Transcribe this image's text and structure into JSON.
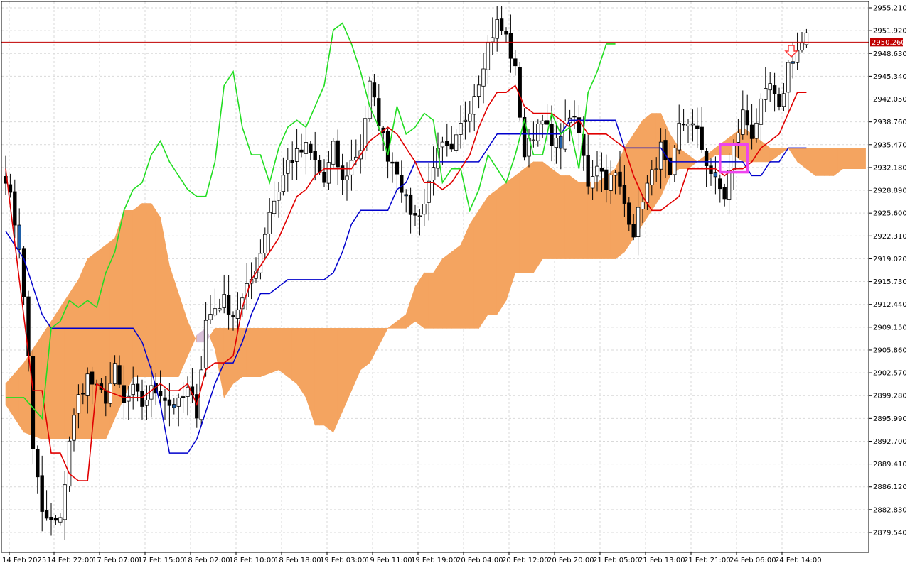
{
  "chart_data": {
    "type": "candlestick",
    "indicator": "ichimoku",
    "current_price": "2950.260",
    "y_ticks": [
      "2955.210",
      "2951.920",
      "2948.630",
      "2945.340",
      "2942.050",
      "2938.760",
      "2935.470",
      "2932.180",
      "2928.890",
      "2925.600",
      "2922.310",
      "2919.020",
      "2915.730",
      "2912.440",
      "2909.150",
      "2905.860",
      "2902.570",
      "2899.280",
      "2895.990",
      "2892.700",
      "2889.410",
      "2886.120",
      "2882.830",
      "2879.540"
    ],
    "x_ticks": [
      "14 Feb 2025",
      "14 Feb 22:00",
      "17 Feb 07:00",
      "17 Feb 15:00",
      "18 Feb 02:00",
      "18 Feb 10:00",
      "18 Feb 18:00",
      "19 Feb 03:00",
      "19 Feb 11:00",
      "19 Feb 19:00",
      "20 Feb 04:00",
      "20 Feb 12:00",
      "20 Feb 20:00",
      "21 Feb 05:00",
      "21 Feb 13:00",
      "21 Feb 21:00",
      "24 Feb 06:00",
      "24 Feb 14:00"
    ],
    "ylim": [
      2876.5,
      2956.8
    ],
    "grid": true,
    "colors": {
      "cloud_bull": "#f4a460",
      "cloud_bear": "#d8bfd8",
      "tenkan": "#e00000",
      "kijun": "#0000cc",
      "chikou": "#22dd22",
      "price_line": "#c00000",
      "highlight_box": "#ee44ee",
      "arrow": "#ff3333"
    },
    "tenkan": [
      [
        0,
        2932
      ],
      [
        6,
        2900
      ],
      [
        8,
        2900
      ],
      [
        10,
        2891
      ],
      [
        12,
        2891
      ],
      [
        14,
        2888
      ],
      [
        16,
        2887
      ],
      [
        18,
        2887
      ],
      [
        20,
        2901
      ],
      [
        22,
        2900
      ],
      [
        26,
        2899
      ],
      [
        30,
        2899
      ],
      [
        34,
        2901
      ],
      [
        36,
        2900
      ],
      [
        38,
        2900
      ],
      [
        40,
        2901
      ],
      [
        42,
        2898
      ],
      [
        44,
        2903
      ],
      [
        46,
        2904
      ],
      [
        48,
        2904
      ],
      [
        50,
        2905
      ],
      [
        52,
        2912
      ],
      [
        54,
        2916
      ],
      [
        56,
        2918
      ],
      [
        58,
        2920
      ],
      [
        60,
        2922
      ],
      [
        62,
        2925
      ],
      [
        64,
        2928
      ],
      [
        66,
        2929
      ],
      [
        68,
        2931
      ],
      [
        70,
        2932
      ],
      [
        72,
        2932
      ],
      [
        74,
        2932
      ],
      [
        76,
        2932
      ],
      [
        78,
        2934
      ],
      [
        80,
        2936
      ],
      [
        82,
        2937
      ],
      [
        84,
        2938
      ],
      [
        86,
        2937
      ],
      [
        88,
        2935
      ],
      [
        90,
        2933
      ],
      [
        92,
        2930
      ],
      [
        94,
        2930
      ],
      [
        96,
        2929
      ],
      [
        98,
        2930
      ],
      [
        100,
        2932
      ],
      [
        102,
        2934
      ],
      [
        104,
        2938
      ],
      [
        106,
        2941
      ],
      [
        108,
        2943
      ],
      [
        110,
        2943
      ],
      [
        112,
        2944
      ],
      [
        114,
        2941
      ],
      [
        116,
        2940
      ],
      [
        118,
        2940
      ],
      [
        120,
        2940
      ],
      [
        122,
        2939
      ],
      [
        124,
        2938
      ],
      [
        126,
        2939
      ],
      [
        128,
        2937
      ],
      [
        130,
        2937
      ],
      [
        132,
        2937
      ],
      [
        134,
        2936
      ],
      [
        136,
        2935
      ],
      [
        138,
        2931
      ],
      [
        140,
        2928
      ],
      [
        142,
        2926
      ],
      [
        144,
        2926
      ],
      [
        146,
        2927
      ],
      [
        148,
        2928
      ],
      [
        150,
        2932
      ],
      [
        152,
        2932
      ],
      [
        154,
        2932
      ],
      [
        156,
        2932
      ],
      [
        158,
        2931
      ],
      [
        160,
        2932
      ],
      [
        162,
        2932
      ],
      [
        164,
        2933
      ],
      [
        166,
        2935
      ],
      [
        168,
        2936
      ],
      [
        170,
        2937
      ],
      [
        172,
        2940
      ],
      [
        174,
        2943
      ],
      [
        176,
        2943
      ]
    ],
    "kijun": [
      [
        0,
        2923
      ],
      [
        4,
        2919
      ],
      [
        6,
        2915
      ],
      [
        8,
        2911
      ],
      [
        10,
        2909
      ],
      [
        12,
        2909
      ],
      [
        14,
        2909
      ],
      [
        16,
        2909
      ],
      [
        18,
        2909
      ],
      [
        20,
        2909
      ],
      [
        22,
        2909
      ],
      [
        24,
        2909
      ],
      [
        26,
        2909
      ],
      [
        28,
        2909
      ],
      [
        30,
        2907
      ],
      [
        32,
        2903
      ],
      [
        34,
        2898
      ],
      [
        36,
        2891
      ],
      [
        38,
        2891
      ],
      [
        40,
        2891
      ],
      [
        42,
        2893
      ],
      [
        44,
        2897
      ],
      [
        46,
        2901
      ],
      [
        48,
        2904
      ],
      [
        50,
        2904
      ],
      [
        52,
        2907
      ],
      [
        54,
        2911
      ],
      [
        56,
        2914
      ],
      [
        58,
        2914
      ],
      [
        60,
        2915
      ],
      [
        62,
        2916
      ],
      [
        64,
        2916
      ],
      [
        66,
        2916
      ],
      [
        68,
        2916
      ],
      [
        70,
        2916
      ],
      [
        72,
        2917
      ],
      [
        74,
        2920
      ],
      [
        76,
        2924
      ],
      [
        78,
        2926
      ],
      [
        80,
        2926
      ],
      [
        82,
        2926
      ],
      [
        84,
        2926
      ],
      [
        86,
        2929
      ],
      [
        88,
        2930
      ],
      [
        90,
        2933
      ],
      [
        92,
        2933
      ],
      [
        94,
        2933
      ],
      [
        96,
        2933
      ],
      [
        98,
        2933
      ],
      [
        100,
        2933
      ],
      [
        102,
        2933
      ],
      [
        104,
        2933
      ],
      [
        106,
        2935
      ],
      [
        108,
        2937
      ],
      [
        110,
        2937
      ],
      [
        112,
        2937
      ],
      [
        114,
        2937
      ],
      [
        116,
        2937
      ],
      [
        118,
        2937
      ],
      [
        120,
        2937
      ],
      [
        122,
        2937
      ],
      [
        124,
        2939
      ],
      [
        126,
        2939
      ],
      [
        128,
        2939
      ],
      [
        130,
        2939
      ],
      [
        132,
        2939
      ],
      [
        134,
        2939
      ],
      [
        136,
        2935
      ],
      [
        138,
        2935
      ],
      [
        140,
        2935
      ],
      [
        142,
        2935
      ],
      [
        144,
        2935
      ],
      [
        146,
        2933
      ],
      [
        148,
        2933
      ],
      [
        150,
        2933
      ],
      [
        152,
        2933
      ],
      [
        154,
        2933
      ],
      [
        156,
        2933
      ],
      [
        158,
        2933
      ],
      [
        160,
        2933
      ],
      [
        162,
        2933
      ],
      [
        164,
        2931
      ],
      [
        166,
        2931
      ],
      [
        168,
        2933
      ],
      [
        170,
        2933
      ],
      [
        172,
        2935
      ],
      [
        174,
        2935
      ],
      [
        176,
        2935
      ]
    ],
    "chikou": [
      [
        0,
        2899
      ],
      [
        4,
        2899
      ],
      [
        8,
        2896
      ],
      [
        10,
        2909
      ],
      [
        12,
        2910
      ],
      [
        14,
        2913
      ],
      [
        16,
        2912
      ],
      [
        18,
        2913
      ],
      [
        20,
        2912
      ],
      [
        22,
        2917
      ],
      [
        24,
        2920
      ],
      [
        26,
        2926
      ],
      [
        28,
        2929
      ],
      [
        30,
        2930
      ],
      [
        32,
        2934
      ],
      [
        34,
        2936
      ],
      [
        36,
        2933
      ],
      [
        38,
        2931
      ],
      [
        40,
        2929
      ],
      [
        42,
        2928
      ],
      [
        44,
        2928
      ],
      [
        46,
        2933
      ],
      [
        48,
        2944
      ],
      [
        50,
        2946
      ],
      [
        52,
        2938
      ],
      [
        54,
        2934
      ],
      [
        56,
        2934
      ],
      [
        58,
        2930
      ],
      [
        60,
        2935
      ],
      [
        62,
        2938
      ],
      [
        64,
        2939
      ],
      [
        66,
        2938
      ],
      [
        68,
        2941
      ],
      [
        70,
        2944
      ],
      [
        72,
        2952
      ],
      [
        74,
        2953
      ],
      [
        76,
        2950
      ],
      [
        78,
        2946
      ],
      [
        80,
        2941
      ],
      [
        82,
        2938
      ],
      [
        84,
        2934
      ],
      [
        86,
        2941
      ],
      [
        88,
        2937
      ],
      [
        90,
        2938
      ],
      [
        92,
        2940
      ],
      [
        94,
        2939
      ],
      [
        96,
        2930
      ],
      [
        98,
        2932
      ],
      [
        100,
        2932
      ],
      [
        102,
        2926
      ],
      [
        104,
        2929
      ],
      [
        106,
        2934
      ],
      [
        108,
        2932
      ],
      [
        110,
        2930
      ],
      [
        112,
        2934
      ],
      [
        114,
        2939
      ],
      [
        116,
        2934
      ],
      [
        118,
        2934
      ],
      [
        120,
        2940
      ],
      [
        122,
        2937
      ],
      [
        124,
        2938
      ],
      [
        126,
        2932
      ],
      [
        128,
        2943
      ],
      [
        130,
        2946
      ],
      [
        132,
        2950
      ],
      [
        134,
        2950
      ]
    ],
    "highlight_box": {
      "x0": 157,
      "x1": 163,
      "y_high": 2935.5,
      "y_low": 2931.5
    },
    "price_range_note": "scale read from axis"
  }
}
